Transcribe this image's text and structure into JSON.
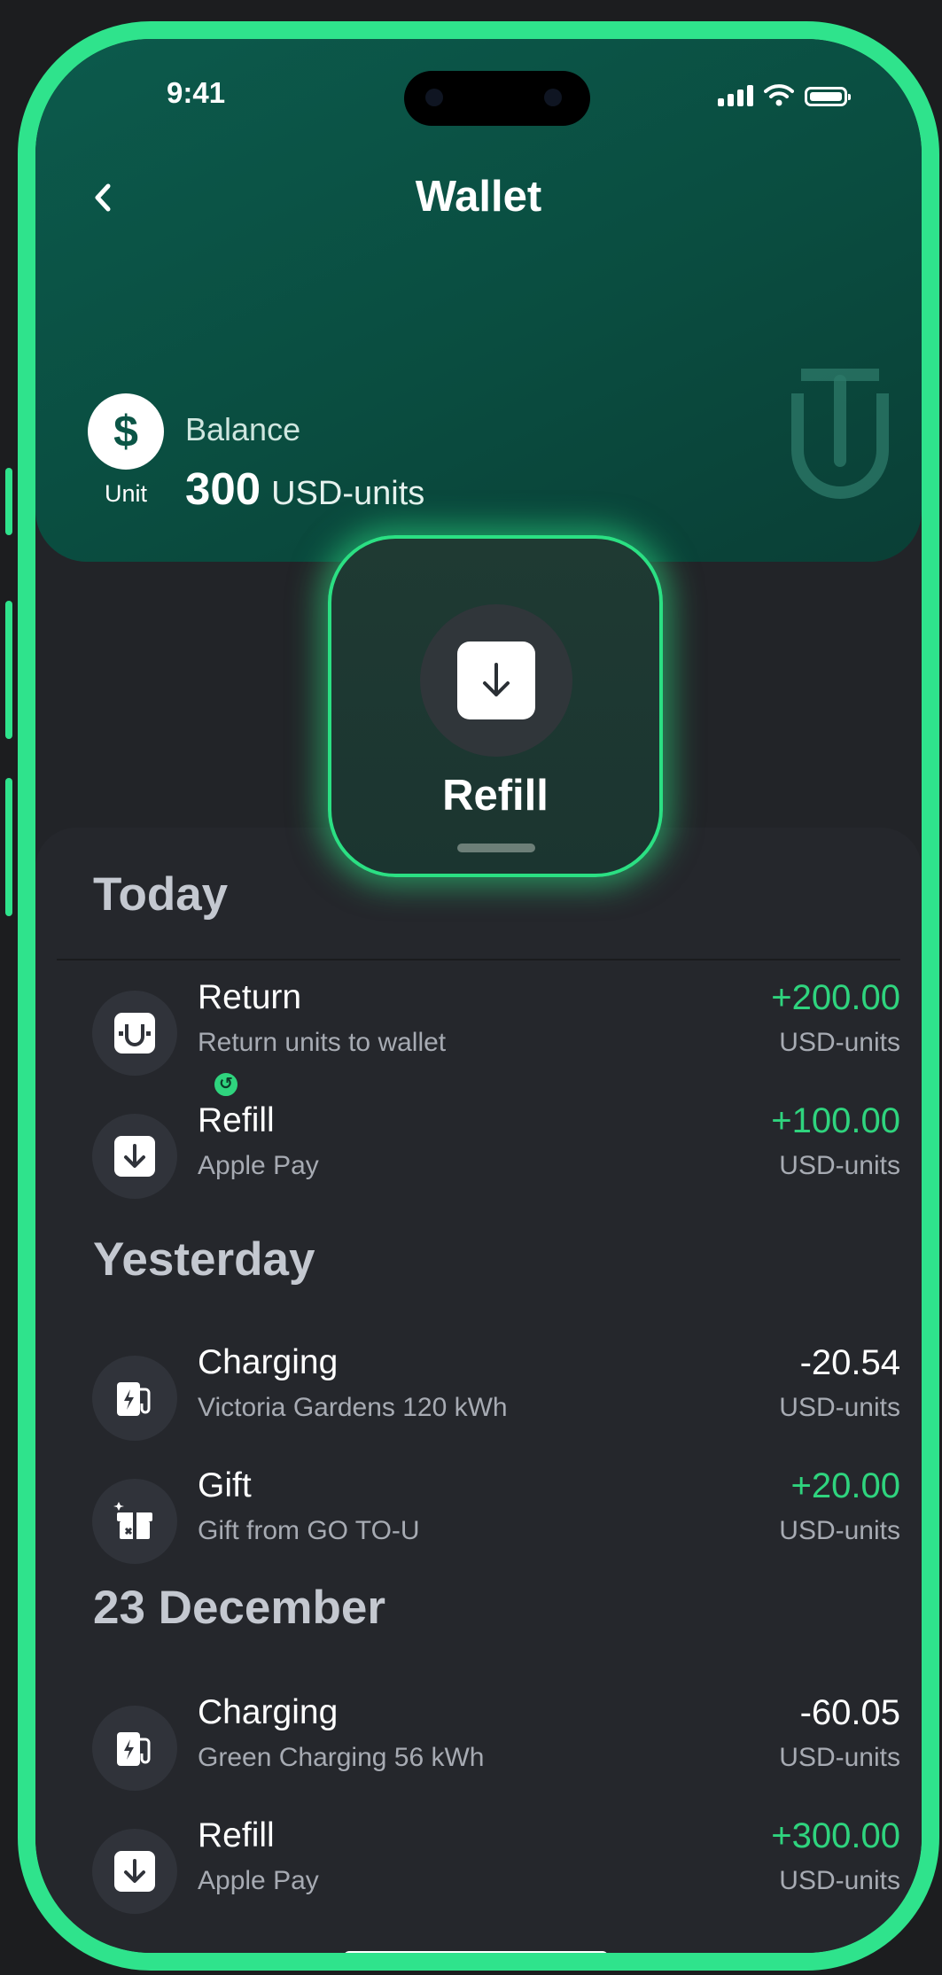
{
  "status_bar": {
    "time": "9:41"
  },
  "header": {
    "title": "Wallet"
  },
  "balance": {
    "coin_symbol": "$",
    "coin_label": "Unit",
    "label": "Balance",
    "amount": "300",
    "unit": "USD-units"
  },
  "refill_button": {
    "label": "Refill"
  },
  "sections": [
    {
      "title": "Today",
      "items": [
        {
          "title": "Return",
          "subtitle": "Return units to wallet",
          "amount": "+200.00",
          "unit": "USD-units",
          "icon": "return-icon"
        },
        {
          "title": "Refill",
          "subtitle": "Apple Pay",
          "amount": "+100.00",
          "unit": "USD-units",
          "icon": "refill-icon"
        }
      ]
    },
    {
      "title": "Yesterday",
      "items": [
        {
          "title": "Charging",
          "subtitle": "Victoria Gardens 120 kWh",
          "amount": "-20.54",
          "unit": "USD-units",
          "icon": "charging-icon"
        },
        {
          "title": "Gift",
          "subtitle": "Gift from GO TO-U",
          "amount": "+20.00",
          "unit": "USD-units",
          "icon": "gift-icon"
        }
      ]
    },
    {
      "title": "23 December",
      "items": [
        {
          "title": "Charging",
          "subtitle": "Green Charging 56 kWh",
          "amount": "-60.05",
          "unit": "USD-units",
          "icon": "charging-icon"
        },
        {
          "title": "Refill",
          "subtitle": "Apple Pay",
          "amount": "+300.00",
          "unit": "USD-units",
          "icon": "refill-icon"
        }
      ]
    }
  ],
  "colors": {
    "accent": "#2fe38c",
    "positive": "#2fd47e",
    "hero": "#0b5546",
    "background": "#222428"
  }
}
